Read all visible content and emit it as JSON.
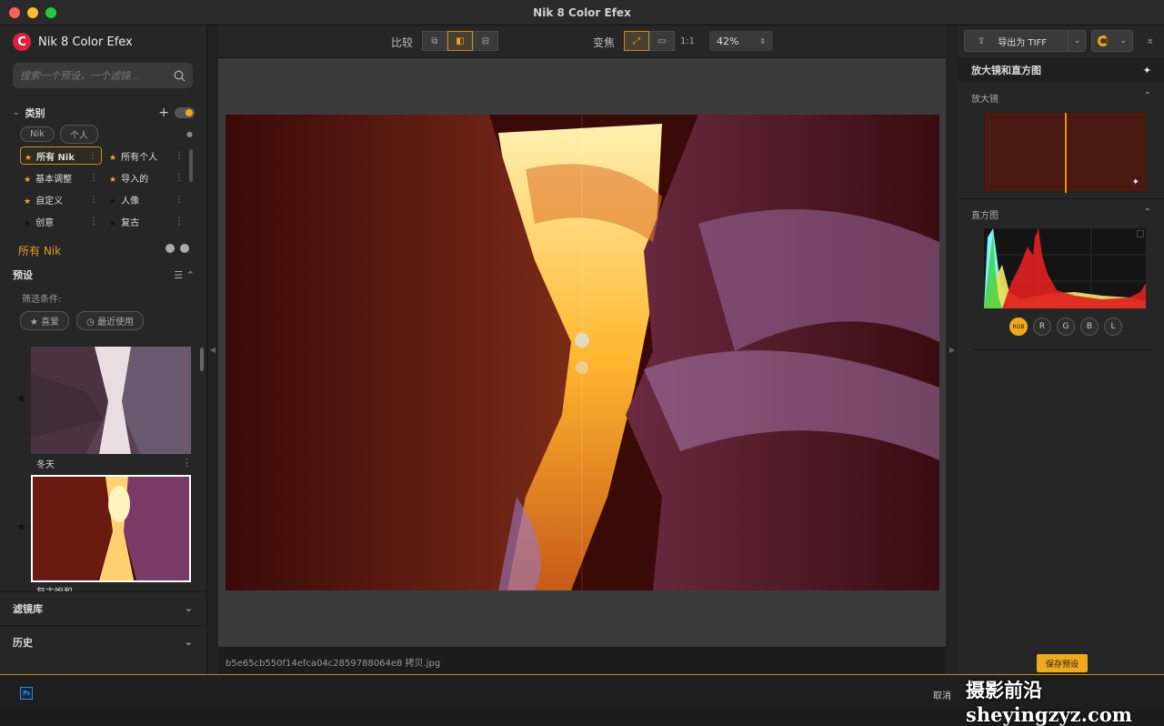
{
  "window": {
    "title": "Nik 8 Color Efex",
    "colors": {
      "close": "#ff5f57",
      "min": "#febc2e",
      "max": "#28c840"
    }
  },
  "app": {
    "name": "Nik 8 Color Efex",
    "accent": "#f0a81c",
    "logo_letter": "C"
  },
  "sidebar": {
    "search_placeholder": "搜索一个预设，一个滤镜...",
    "category_title": "类别",
    "tags": [
      "Nik",
      "个人"
    ],
    "categories": [
      {
        "label": "所有 Nik",
        "starred": true,
        "active": true
      },
      {
        "label": "所有个人",
        "starred": true
      },
      {
        "label": "基本调整",
        "starred": true
      },
      {
        "label": "导入的",
        "starred": true
      },
      {
        "label": "自定义",
        "starred": true
      },
      {
        "label": "人像",
        "starred": false
      },
      {
        "label": "创意",
        "starred": false
      },
      {
        "label": "复古",
        "starred": false
      }
    ],
    "current_category": "所有 Nik",
    "presets_title": "预设",
    "filter_label": "筛选条件:",
    "filters": [
      "喜爱",
      "最近使用"
    ],
    "presets": [
      {
        "name": "冬天"
      },
      {
        "name": "复古饱和"
      }
    ],
    "filter_library": "滤镜库",
    "history": "历史"
  },
  "toolbar": {
    "compare_label": "比较",
    "zoom_label": "变焦",
    "one_to_one": "1:1",
    "zoom_value": "42%"
  },
  "canvas": {
    "filename": "b5e65cb550f14efca04c2859788064e8 拷贝.jpg"
  },
  "right_panel": {
    "export_label": "导出为 TIFF",
    "section_title": "放大镜和直方图",
    "loupe_label": "放大镜",
    "histogram_label": "直方图",
    "channels": [
      "RGB",
      "R",
      "G",
      "B",
      "L"
    ],
    "save_preset": "保存预设"
  },
  "bottom": {
    "ps": "Ps",
    "cancel": "取消",
    "watermark": "摄影前沿 sheyingzyz.com"
  }
}
